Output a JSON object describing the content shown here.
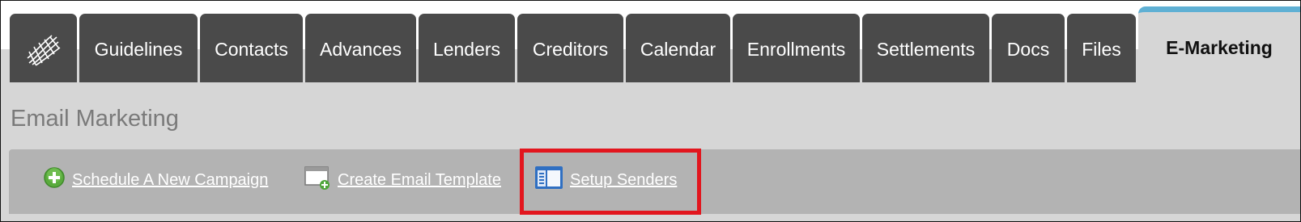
{
  "tabs": [
    {
      "id": "logo",
      "label": ""
    },
    {
      "id": "guidelines",
      "label": "Guidelines"
    },
    {
      "id": "contacts",
      "label": "Contacts"
    },
    {
      "id": "advances",
      "label": "Advances"
    },
    {
      "id": "lenders",
      "label": "Lenders"
    },
    {
      "id": "creditors",
      "label": "Creditors"
    },
    {
      "id": "calendar",
      "label": "Calendar"
    },
    {
      "id": "enrollments",
      "label": "Enrollments"
    },
    {
      "id": "settlements",
      "label": "Settlements"
    },
    {
      "id": "docs",
      "label": "Docs"
    },
    {
      "id": "files",
      "label": "Files"
    },
    {
      "id": "emarketing",
      "label": "E-Marketing",
      "active": true
    }
  ],
  "section": {
    "title": "Email Marketing"
  },
  "toolbar": {
    "schedule_label": "Schedule A New Campaign",
    "template_label": "Create Email Template",
    "senders_label": "Setup Senders"
  },
  "colors": {
    "tab_bg": "#4a4a4a",
    "active_tab_accent": "#5fb0d4",
    "page_bg": "#d6d6d6",
    "toolbar_bg": "#b3b3b3",
    "highlight": "#e2161e"
  }
}
